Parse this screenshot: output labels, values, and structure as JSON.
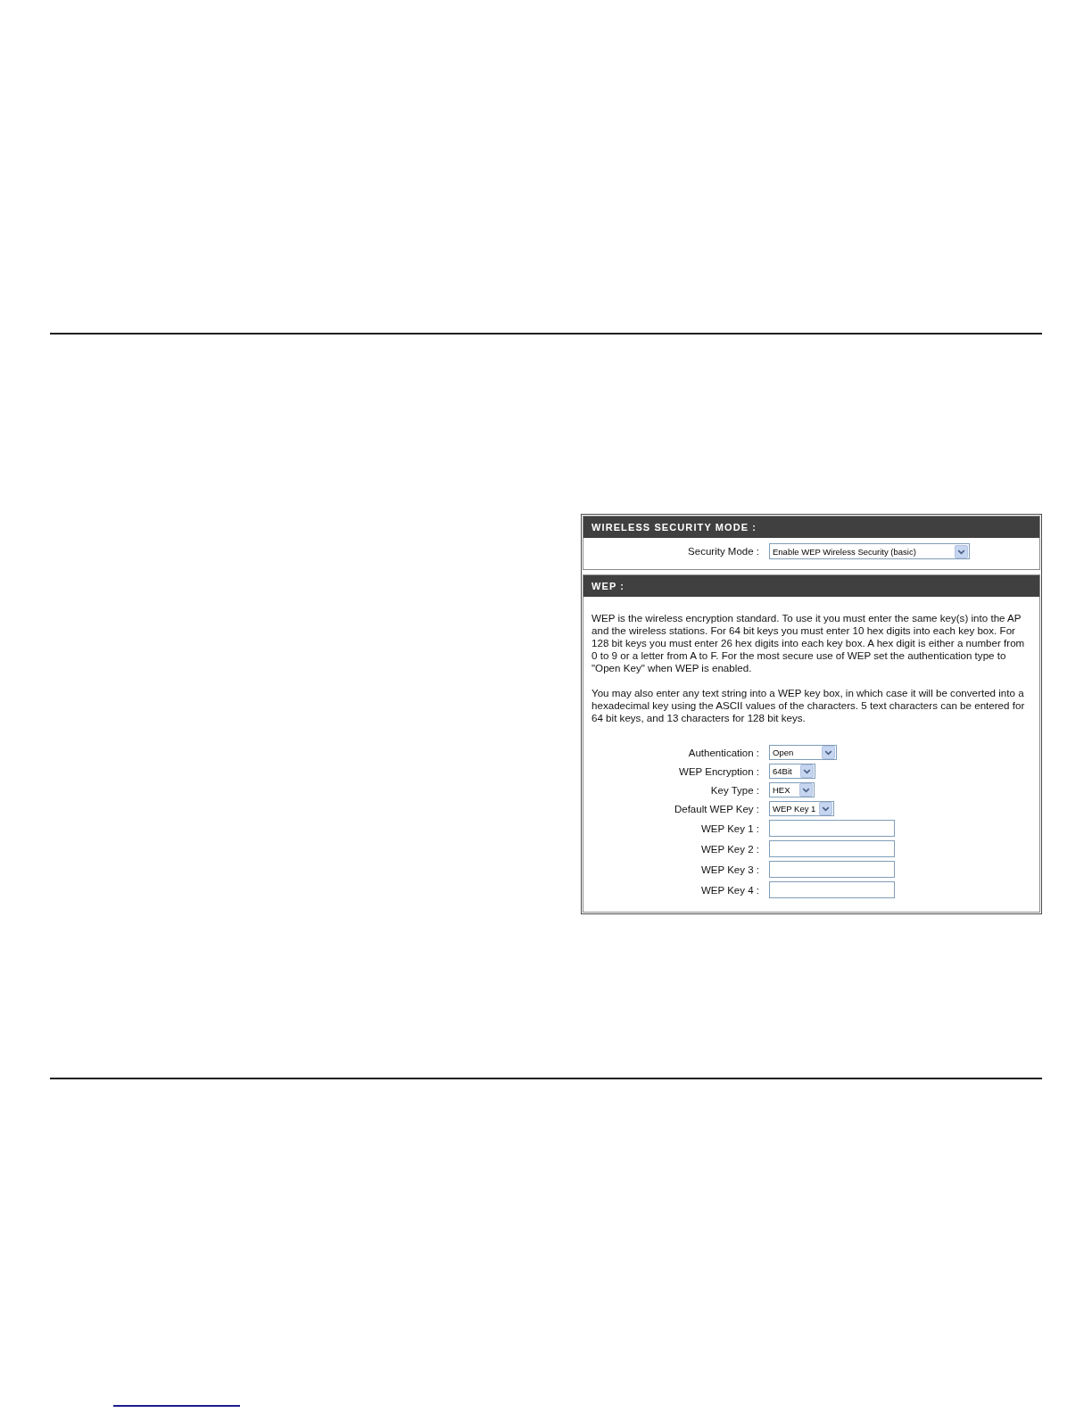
{
  "sections": [
    {
      "title": "WIRELESS SECURITY MODE :",
      "fields": [
        {
          "kind": "select",
          "label": "Security Mode :",
          "value": "Enable WEP Wireless Security (basic)"
        }
      ]
    },
    {
      "title": "WEP :",
      "paragraphs": [
        "WEP is the wireless encryption standard. To use it you must enter the same key(s) into the AP and the wireless stations. For 64 bit keys you must enter 10 hex digits into each key box. For 128 bit keys you must enter 26 hex digits into each key box. A hex digit is either a number from 0 to 9 or a letter from A to F. For the most secure use of WEP set the authentication type to \"Open Key\" when WEP is enabled.",
        "You may also enter any text string into a WEP key box, in which case it will be converted into a hexadecimal key using the ASCII values of the characters. 5 text characters can be entered for 64 bit keys, and 13 characters for 128 bit keys."
      ],
      "fields": [
        {
          "kind": "select",
          "label": "Authentication :",
          "value": "Open"
        },
        {
          "kind": "select",
          "label": "WEP Encryption :",
          "value": "64Bit"
        },
        {
          "kind": "select",
          "label": "Key Type :",
          "value": "HEX"
        },
        {
          "kind": "select",
          "label": "Default WEP Key :",
          "value": "WEP Key 1"
        },
        {
          "kind": "input",
          "label": "WEP Key 1 :"
        },
        {
          "kind": "input",
          "label": "WEP Key 2 :"
        },
        {
          "kind": "input",
          "label": "WEP Key 3 :"
        },
        {
          "kind": "input",
          "label": "WEP Key 4 :"
        }
      ]
    }
  ]
}
